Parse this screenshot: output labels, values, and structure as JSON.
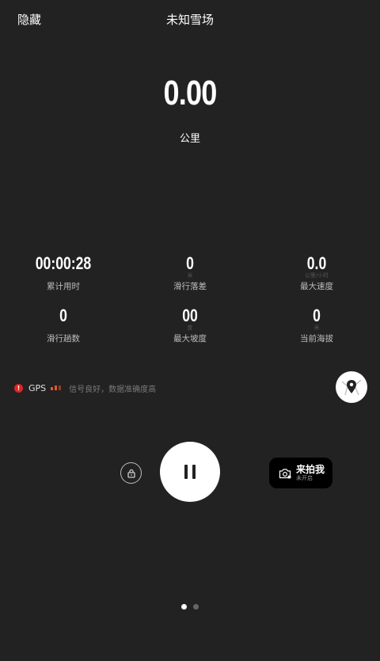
{
  "header": {
    "hide_label": "隐藏",
    "title": "未知雪场"
  },
  "distance": {
    "value": "0.00",
    "unit": "公里"
  },
  "stats": [
    {
      "value": "00:00:28",
      "unit": "",
      "label": "累计用时"
    },
    {
      "value": "0",
      "unit": "米",
      "label": "滑行落差"
    },
    {
      "value": "0.0",
      "unit": "公里/小时",
      "label": "最大速度"
    },
    {
      "value": "0",
      "unit": "",
      "label": "滑行趟数"
    },
    {
      "value": "00",
      "unit": "度",
      "label": "最大坡度"
    },
    {
      "value": "0",
      "unit": "米",
      "label": "当前海拔"
    }
  ],
  "gps": {
    "label": "GPS",
    "status_icon": "warning-icon",
    "message": "信号良好，数据准确度高",
    "bar_color": "#e4572e",
    "warn_color": "#e02424"
  },
  "controls": {
    "map_icon": "map-pin-icon",
    "lock_icon": "lock-icon",
    "pause_icon": "pause-icon"
  },
  "shoot": {
    "label": "来拍我",
    "sub": "未开启",
    "icon": "camera-icon"
  },
  "pager": {
    "pages": 2,
    "active": 1
  }
}
